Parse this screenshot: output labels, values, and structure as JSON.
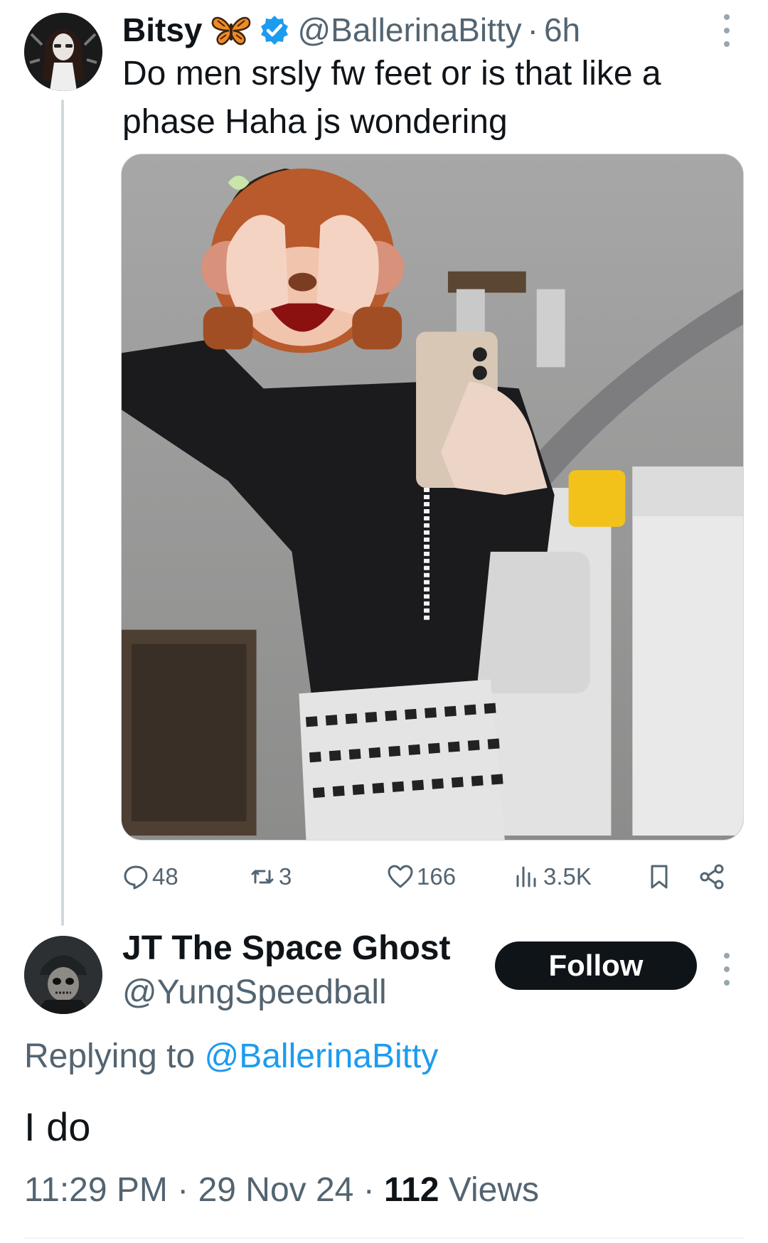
{
  "parent_tweet": {
    "display_name": "Bitsy",
    "handle": "@BallerinaBitty",
    "separator": "·",
    "time_ago": "6h",
    "text": "Do men srsly fw feet or is that like a phase Haha js wondering",
    "name_emoji": "butterfly-icon",
    "verified": true,
    "media_alt": "",
    "metrics": {
      "replies": "48",
      "reposts": "3",
      "likes": "166",
      "views": "3.5K"
    }
  },
  "reply_tweet": {
    "display_name": "JT The Space Ghost",
    "handle": "@YungSpeedball",
    "follow_label": "Follow",
    "replying_prefix": "Replying to",
    "replying_to": "@BallerinaBitty",
    "text": "I do",
    "time": "11:29 PM",
    "date": "29 Nov 24",
    "separator": "·",
    "views_count": "112",
    "views_label": "Views"
  },
  "colors": {
    "primary_text": "#0f1419",
    "secondary_text": "#536471",
    "link": "#1d9bf0",
    "verified_badge": "#1d9bf0",
    "thread_line": "#cfd9de",
    "follow_bg": "#0f1419"
  }
}
